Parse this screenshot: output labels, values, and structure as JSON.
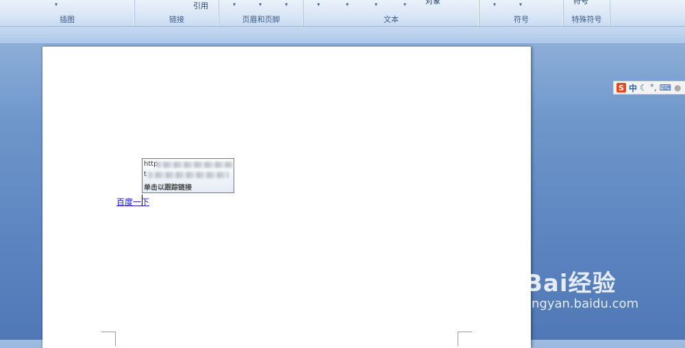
{
  "ribbon": {
    "groups": [
      {
        "label": "插图"
      },
      {
        "label": "链接",
        "button": "引用"
      },
      {
        "label": "页眉和页脚"
      },
      {
        "label": "文本",
        "button": "对象"
      },
      {
        "label": "符号"
      },
      {
        "label": "特殊符号",
        "button": "符号"
      }
    ]
  },
  "document": {
    "link_text": "百度一下"
  },
  "tooltip": {
    "url_prefix_line1": "http",
    "url_prefix_line2": "t",
    "hint": "单击以跟踪链接"
  },
  "ime": {
    "logo": "S",
    "mode": "中"
  },
  "watermark": {
    "brand": "Bai经验",
    "url": "jingyan.baidu.com"
  }
}
